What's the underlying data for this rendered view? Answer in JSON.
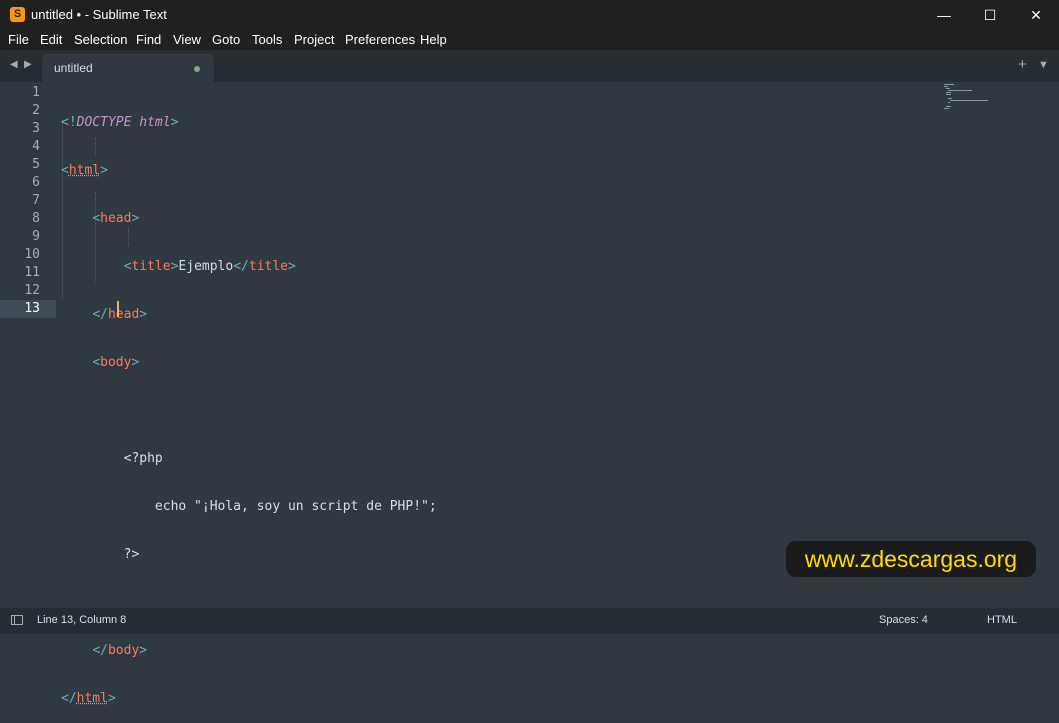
{
  "window": {
    "title": "untitled • - Sublime Text",
    "app_icon": "S",
    "controls": {
      "minimize": "—",
      "maximize": "☐",
      "close": "✕"
    }
  },
  "menu": [
    "File",
    "Edit",
    "Selection",
    "Find",
    "View",
    "Goto",
    "Tools",
    "Project",
    "Preferences",
    "Help"
  ],
  "tabs": [
    {
      "label": "untitled",
      "modified": true
    }
  ],
  "tabbar_tools": {
    "new_tab": "+",
    "tab_list": "▼"
  },
  "nav": {
    "back": "◀",
    "forward": "▶"
  },
  "editor": {
    "line_numbers": [
      "1",
      "2",
      "3",
      "4",
      "5",
      "6",
      "7",
      "8",
      "9",
      "10",
      "11",
      "12",
      "13"
    ],
    "current_line": 13,
    "code_lines": [
      "<!DOCTYPE html>",
      "<html>",
      "    <head>",
      "        <title>Ejemplo</title>",
      "    </head>",
      "    <body>",
      "",
      "        <?php",
      "            echo \"¡Hola, soy un script de PHP!\";",
      "        ?>",
      "",
      "    </body>",
      "</html>"
    ]
  },
  "watermark": "www.zdescargas.org",
  "status": {
    "position": "Line 13, Column 8",
    "indentation": "Spaces: 4",
    "syntax": "HTML"
  },
  "colors": {
    "background": "#303841",
    "tag": "#f97b58",
    "punctuation": "#5fb4b4",
    "keyword": "#c695c6",
    "caret": "#f9ae58",
    "watermark_text": "#ffdd00"
  }
}
